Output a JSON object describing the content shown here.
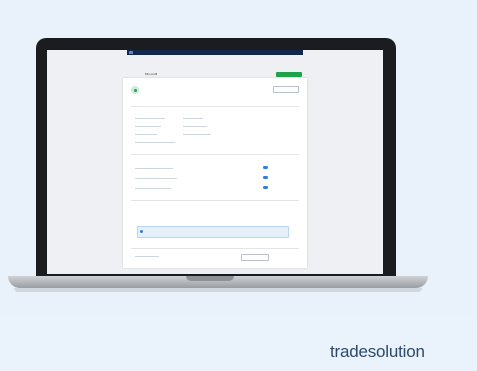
{
  "brand": {
    "name": "tradesolution"
  },
  "app": {
    "page_title": "Min profil",
    "create_button": "",
    "profile": {
      "name": "",
      "subtitle_lines": [
        "",
        ""
      ],
      "edit_button": ""
    },
    "sections": [
      {
        "title": ""
      },
      {
        "title": ""
      },
      {
        "title": ""
      }
    ],
    "toggles": [
      true,
      true,
      true
    ],
    "info_box": {
      "title": "",
      "text": ""
    }
  },
  "colors": {
    "topbar": "#11284b",
    "accent": "#1fa34a",
    "toggle": "#2e7de1",
    "brand": "#2d4a6c"
  }
}
